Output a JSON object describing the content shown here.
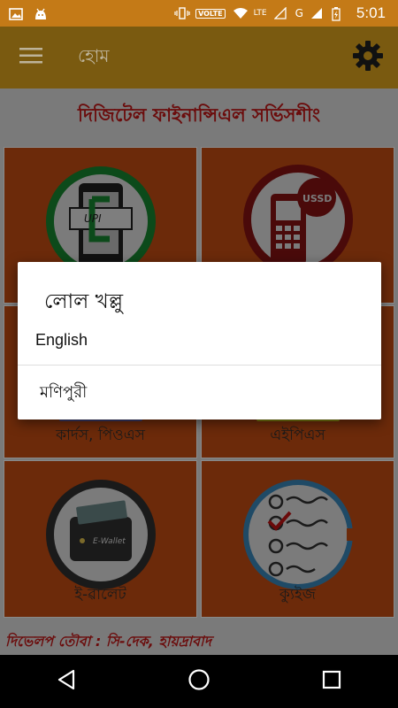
{
  "status_bar": {
    "icons_left": [
      "image-icon",
      "android-icon"
    ],
    "volte": "VOLTE",
    "network_left": "LTE",
    "network_right": "G",
    "time": "5:01"
  },
  "app_bar": {
    "title": "হোম"
  },
  "heading": "দিজিটেল ফাইনান্সিএল সর্ভিসশীং",
  "tiles": [
    {
      "label": "",
      "icon": "upi-phone-icon"
    },
    {
      "label": "",
      "icon": "ussd-phone-icon"
    },
    {
      "label": "কার্দস, পিওএস",
      "icon": "cards-pos-icon"
    },
    {
      "label": "এইপিএস",
      "icon": "aeps-icon"
    },
    {
      "label": "ই-ৱালেট",
      "icon": "e-wallet-icon"
    },
    {
      "label": "ক্যুইজ",
      "icon": "quiz-icon"
    }
  ],
  "icon_texts": {
    "upi": "UPI",
    "ussd": "USSD",
    "wallet": "E-Wallet"
  },
  "footer": "দিভেলপ তৌবা : সি-দেক, হায়দ্রাবাদ",
  "dialog": {
    "title": "লোল খল্লু",
    "options": [
      "English",
      "মণিপুরী"
    ]
  },
  "colors": {
    "status_bar": "#c47a17",
    "app_bar": "#7a5a10",
    "tile": "#6c2a0a",
    "heading_text": "#6b0c0c"
  }
}
